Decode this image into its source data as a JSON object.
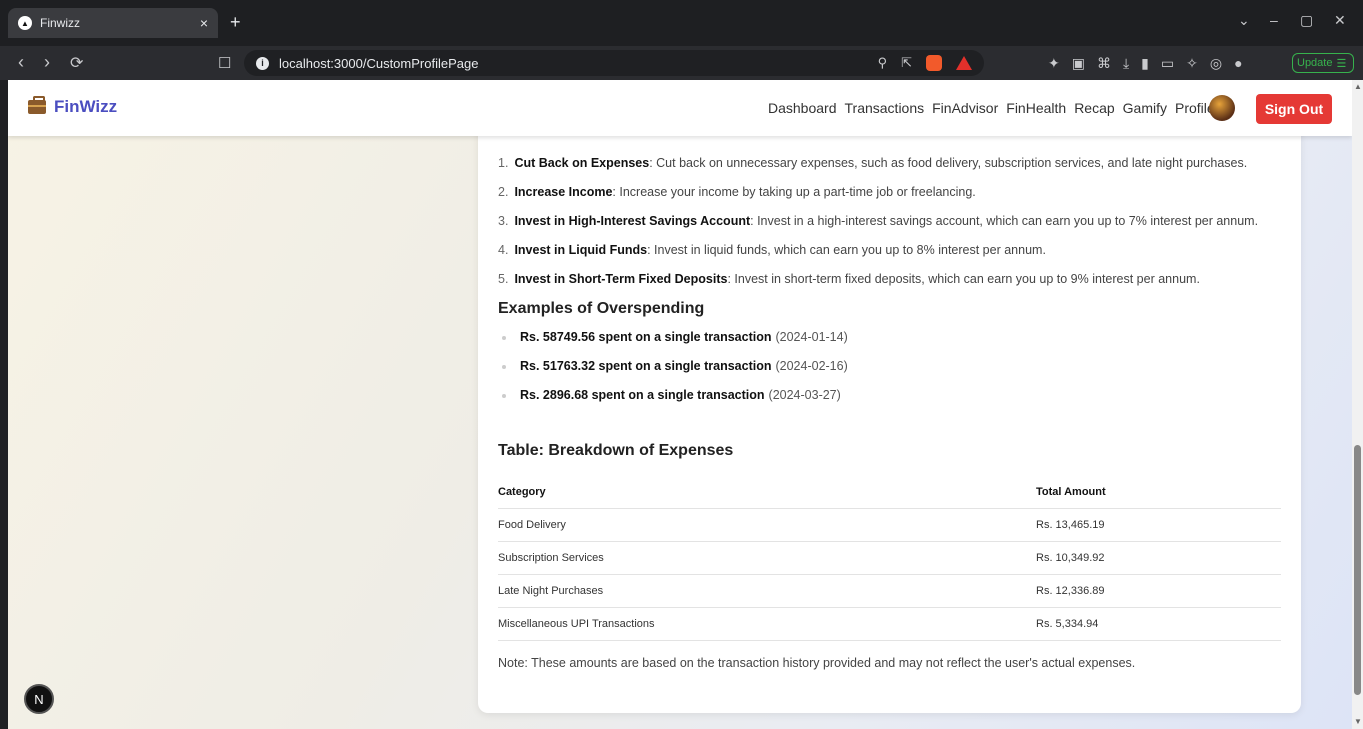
{
  "browser": {
    "tab_title": "Finwizz",
    "tab_close": "×",
    "new_tab": "+",
    "url": "localhost:3000/CustomProfilePage",
    "update_label": "Update",
    "window_controls": [
      "⌄",
      "–",
      "▢",
      "✕"
    ]
  },
  "navbar": {
    "brand": "FinWizz",
    "links": [
      "Dashboard",
      "Transactions",
      "FinAdvisor",
      "FinHealth",
      "Recap",
      "Gamify",
      "Profile"
    ],
    "signout": "Sign Out"
  },
  "tips": [
    {
      "num": "1.",
      "title": "Cut Back on Expenses",
      "text": ": Cut back on unnecessary expenses, such as food delivery, subscription services, and late night purchases."
    },
    {
      "num": "2.",
      "title": "Increase Income",
      "text": ": Increase your income by taking up a part-time job or freelancing."
    },
    {
      "num": "3.",
      "title": "Invest in High-Interest Savings Account",
      "text": ": Invest in a high-interest savings account, which can earn you up to 7% interest per annum."
    },
    {
      "num": "4.",
      "title": "Invest in Liquid Funds",
      "text": ": Invest in liquid funds, which can earn you up to 8% interest per annum."
    },
    {
      "num": "5.",
      "title": "Invest in Short-Term Fixed Deposits",
      "text": ": Invest in short-term fixed deposits, which can earn you up to 9% interest per annum."
    }
  ],
  "overspending": {
    "heading": "Examples of Overspending",
    "items": [
      {
        "bold": "Rs. 58749.56 spent on a single transaction",
        "date": "(2024-01-14)"
      },
      {
        "bold": "Rs. 51763.32 spent on a single transaction",
        "date": "(2024-02-16)"
      },
      {
        "bold": "Rs. 2896.68 spent on a single transaction",
        "date": "(2024-03-27)"
      }
    ]
  },
  "table": {
    "heading": "Table: Breakdown of Expenses",
    "columns": [
      "Category",
      "Total Amount"
    ],
    "rows": [
      [
        "Food Delivery",
        "Rs. 13,465.19"
      ],
      [
        "Subscription Services",
        "Rs. 10,349.92"
      ],
      [
        "Late Night Purchases",
        "Rs. 12,336.89"
      ],
      [
        "Miscellaneous UPI Transactions",
        "Rs. 5,334.94"
      ]
    ]
  },
  "note": "Note: These amounts are based on the transaction history provided and may not reflect the user's actual expenses.",
  "next_badge": "N"
}
